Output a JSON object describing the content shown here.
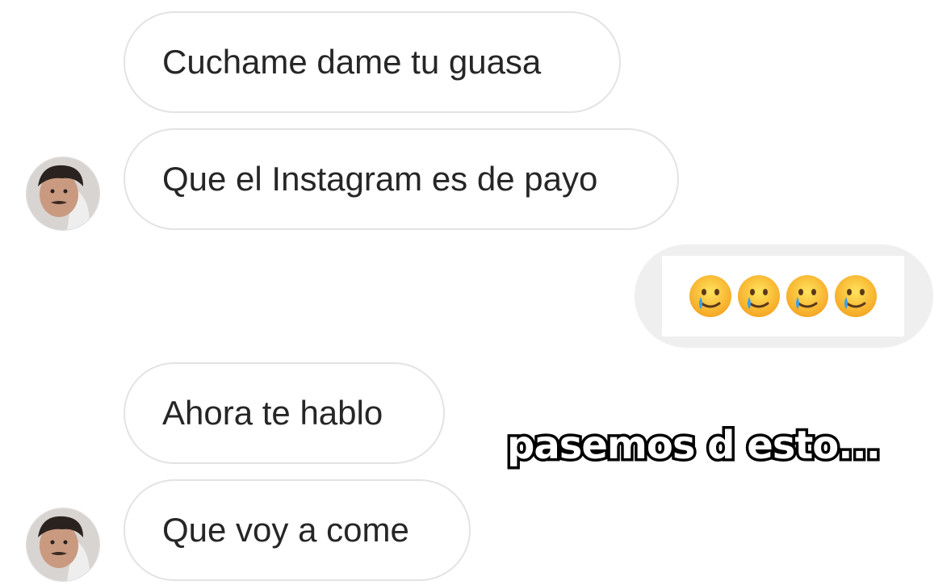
{
  "messages": [
    {
      "sender": "other",
      "text": "Cuchame dame tu guasa"
    },
    {
      "sender": "other",
      "text": "Que el Instagram es de payo"
    },
    {
      "sender": "me",
      "content": "crying-smiling-face emoji x4"
    },
    {
      "sender": "other",
      "text": "Ahora te hablo"
    },
    {
      "sender": "other",
      "text": "Que voy a come"
    }
  ],
  "sent_emoji": {
    "icon": "face-holding-back-tears-icon",
    "count": 4
  },
  "overlay_caption": "pasemos d esto...",
  "colors": {
    "background": "#ffffff",
    "bubble_border": "#e3e3e3",
    "text": "#262626",
    "sent_bubble_bg": "#efefef",
    "caption_fill": "#ffffff",
    "caption_stroke": "#000000"
  }
}
